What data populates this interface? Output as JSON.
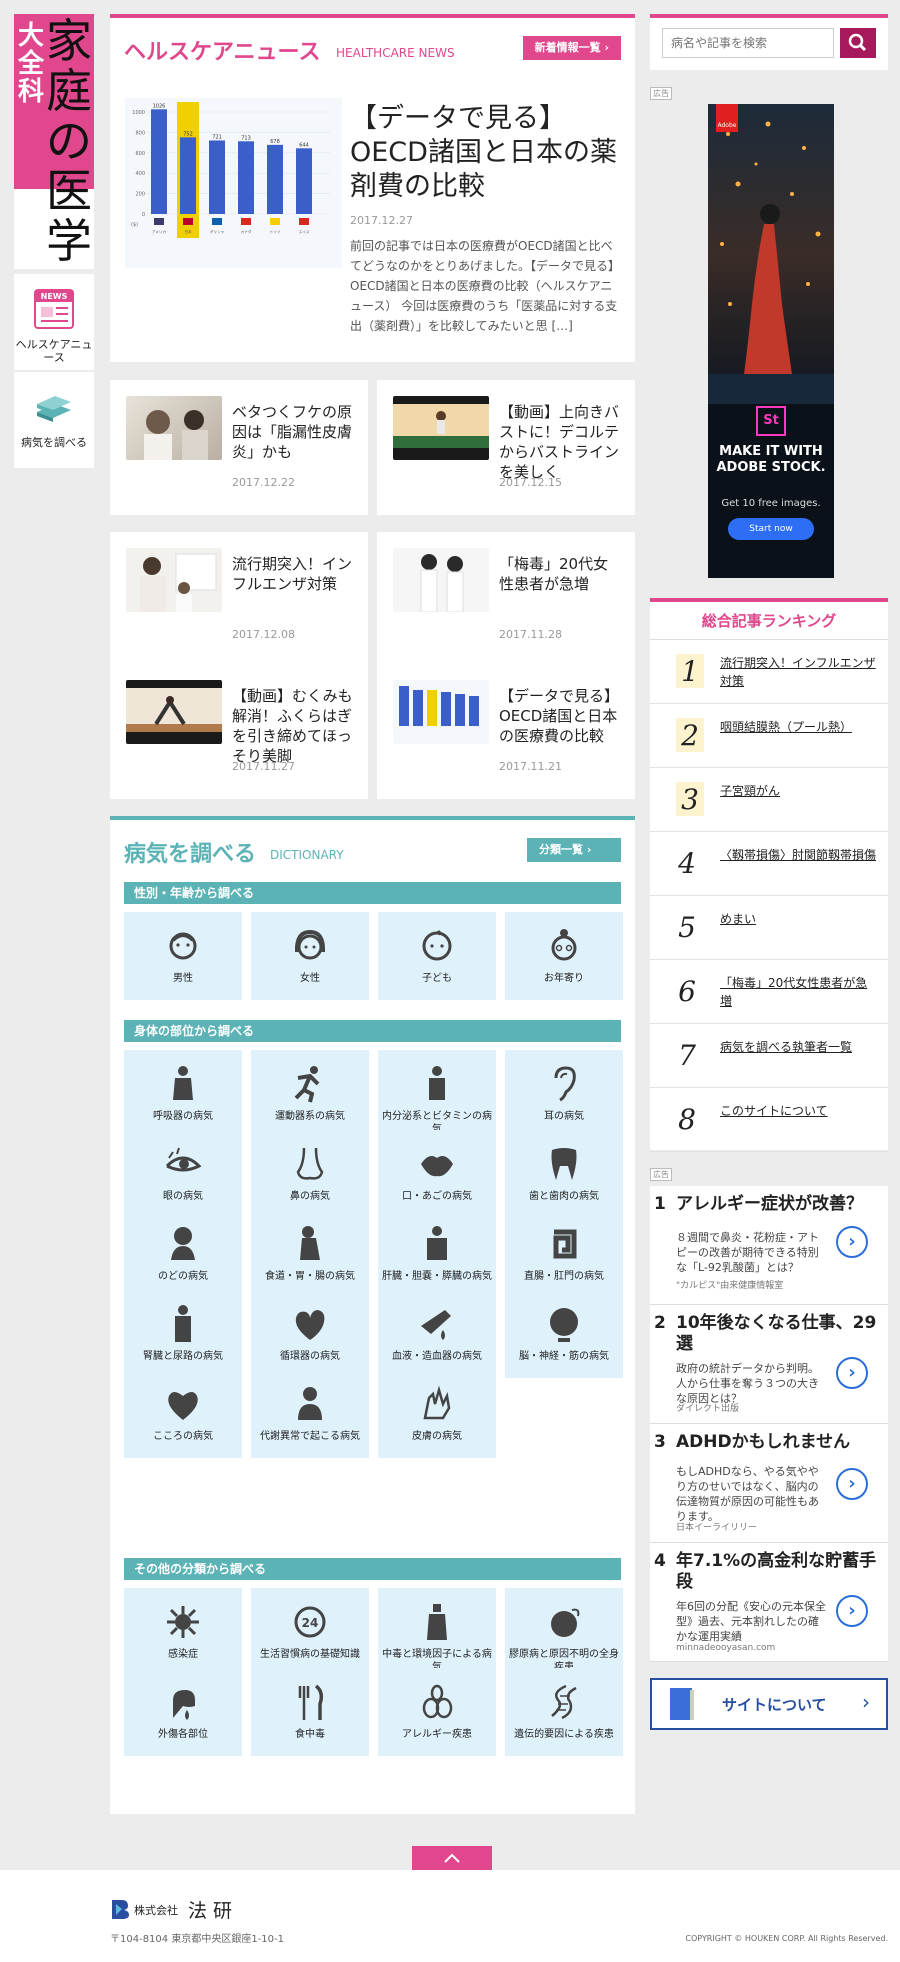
{
  "logo": {
    "small": "大全科",
    "large": "家庭の医学"
  },
  "nav": {
    "news_label": "ヘルスケアニュース",
    "news_badge": "NEWS",
    "dict_label": "病気を調べる"
  },
  "news": {
    "title": "ヘルスケアニュース",
    "subtitle": "HEALTHCARE NEWS",
    "more": "新着情報一覧",
    "featured": {
      "title": "【データで見る】OECD諸国と日本の薬剤費の比較",
      "date": "2017.12.27",
      "excerpt": "前回の記事では日本の医療費がOECD諸国と比べてどうなのかをとりあげました。【データで見る】OECD諸国と日本の医療費の比較（ヘルスケアニュース） 今回は医療費のうち「医薬品に対する支出（薬剤費）」を比較してみたいと思 […]"
    },
    "cards": [
      {
        "title": "ベタつくフケの原因は「脂漏性皮膚炎」かも",
        "date": "2017.12.22"
      },
      {
        "title": "【動画】上向きバストに！デコルテからバストラインを美しく",
        "date": "2017.12.15"
      },
      {
        "title": "流行期突入！インフルエンザ対策",
        "date": "2017.12.08"
      },
      {
        "title": "「梅毒」20代女性患者が急増",
        "date": "2017.11.28"
      },
      {
        "title": "【動画】むくみも解消！ふくらはぎを引き締めてほっそり美脚",
        "date": "2017.11.27"
      },
      {
        "title": "【データで見る】OECD諸国と日本の医療費の比較",
        "date": "2017.11.21"
      }
    ]
  },
  "chart_data": {
    "type": "bar",
    "title": "",
    "ylim": [
      0,
      1000
    ],
    "yticks": [
      "1000",
      "800",
      "600",
      "400",
      "200",
      "0"
    ],
    "ylabel": "($)",
    "categories": [
      "アメリカ",
      "日本",
      "ギリシャ",
      "カナダ",
      "ドイツ",
      "スイス"
    ],
    "values": [
      1026,
      752,
      721,
      713,
      678,
      644
    ],
    "highlight_index": 1,
    "colors": {
      "bar": "#3a5fc8",
      "highlight": "#f0d000"
    }
  },
  "dict": {
    "title": "病気を調べる",
    "subtitle": "DICTIONARY",
    "more": "分類一覧",
    "sections": [
      {
        "heading": "性別・年齢から調べる",
        "items": [
          "男性",
          "女性",
          "子ども",
          "お年寄り"
        ]
      },
      {
        "heading": "身体の部位から調べる",
        "items": [
          "呼吸器の病気",
          "運動器系の病気",
          "内分泌系とビタミンの病気",
          "耳の病気",
          "眼の病気",
          "鼻の病気",
          "口・あごの病気",
          "歯と歯肉の病気",
          "のどの病気",
          "食道・胃・腸の病気",
          "肝臓・胆嚢・膵臓の病気",
          "直腸・肛門の病気",
          "腎臓と尿路の病気",
          "循環器の病気",
          "血液・造血器の病気",
          "脳・神経・筋の病気",
          "こころの病気",
          "代謝異常で起こる病気",
          "皮膚の病気"
        ]
      },
      {
        "heading": "その他の分類から調べる",
        "items": [
          "感染症",
          "生活習慣病の基礎知識",
          "中毒と環境因子による病気",
          "膠原病と原因不明の全身疾患",
          "外傷各部位",
          "食中毒",
          "アレルギー疾患",
          "遺伝的要因による疾患"
        ]
      }
    ]
  },
  "search": {
    "placeholder": "病名や記事を検索"
  },
  "ad_label": "広告",
  "adobe": {
    "badge": "Adobe",
    "st": "St",
    "headline": "MAKE IT WITH ADOBE STOCK.",
    "sub": "Get 10 free images.",
    "cta": "Start now"
  },
  "ranking": {
    "title": "総合記事ランキング",
    "items": [
      {
        "rank": "1",
        "text": "流行期突入！インフルエンザ対策"
      },
      {
        "rank": "2",
        "text": "咽頭結膜熱（プール熱）"
      },
      {
        "rank": "3",
        "text": "子宮頸がん"
      },
      {
        "rank": "4",
        "text": "〈靱帯損傷〉肘関節靱帯損傷"
      },
      {
        "rank": "5",
        "text": "めまい"
      },
      {
        "rank": "6",
        "text": "「梅毒」20代女性患者が急増"
      },
      {
        "rank": "7",
        "text": "病気を調べる執筆者一覧"
      },
      {
        "rank": "8",
        "text": "このサイトについて"
      }
    ]
  },
  "ads": [
    {
      "num": "1",
      "title": "アレルギー症状が改善？",
      "body": "８週間で鼻炎・花粉症・アトピーの改善が期待できる特別な「L-92乳酸菌」とは？",
      "source": "\"カルピス\"由来健康情報室"
    },
    {
      "num": "2",
      "title": "10年後なくなる仕事、29選",
      "body": "政府の統計データから判明。人から仕事を奪う３つの大きな原因とは？",
      "source": "ダイレクト出版"
    },
    {
      "num": "3",
      "title": "ADHDかもしれません",
      "body": "もしADHDなら、やる気ややり方のせいではなく、脳内の伝達物質が原因の可能性もあります。",
      "source": "日本イーライリリー"
    },
    {
      "num": "4",
      "title": "年7.1%の高金利な貯蓄手段",
      "body": "年6回の分配《安心の元本保全型》過去、元本割れしたの確かな運用実績",
      "source": "minnadeooyasan.com"
    }
  ],
  "about": {
    "label": "サイトについて"
  },
  "footer": {
    "company_prefix": "株式会社",
    "company": "法 研",
    "address": "〒104-8104 東京都中央区銀座1-10-1",
    "copyright": "COPYRIGHT © HOUKEN CORP. All Rights Reserved."
  },
  "colors": {
    "pink": "#e0478d",
    "teal": "#5cb3b6",
    "tile": "#dff2fc",
    "navy": "#274fa0"
  }
}
